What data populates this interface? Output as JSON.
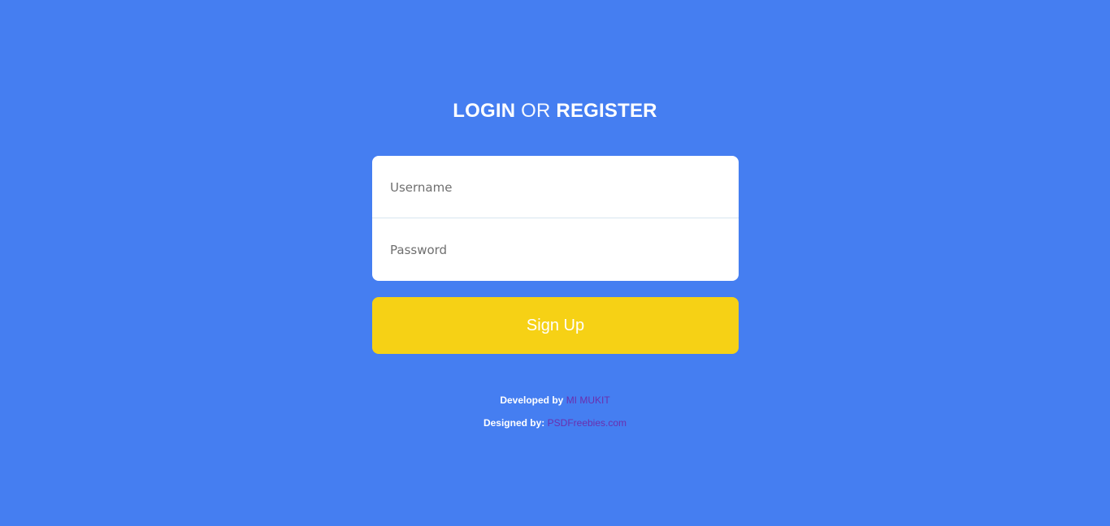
{
  "title": {
    "part1": "LOGIN",
    "part2": "OR",
    "part3": "REGISTER"
  },
  "form": {
    "username_placeholder": "Username",
    "password_placeholder": "Password"
  },
  "signup": {
    "label": "Sign Up"
  },
  "credits": {
    "developed_label": "Developed by",
    "developer_name": "MI MUKIT",
    "designed_label": "Designed by:",
    "designer_name": "PSDFreebies.com"
  },
  "colors": {
    "background": "#457ef1",
    "card": "#ffffff",
    "button": "#f6d115",
    "link": "#6a2fae"
  }
}
